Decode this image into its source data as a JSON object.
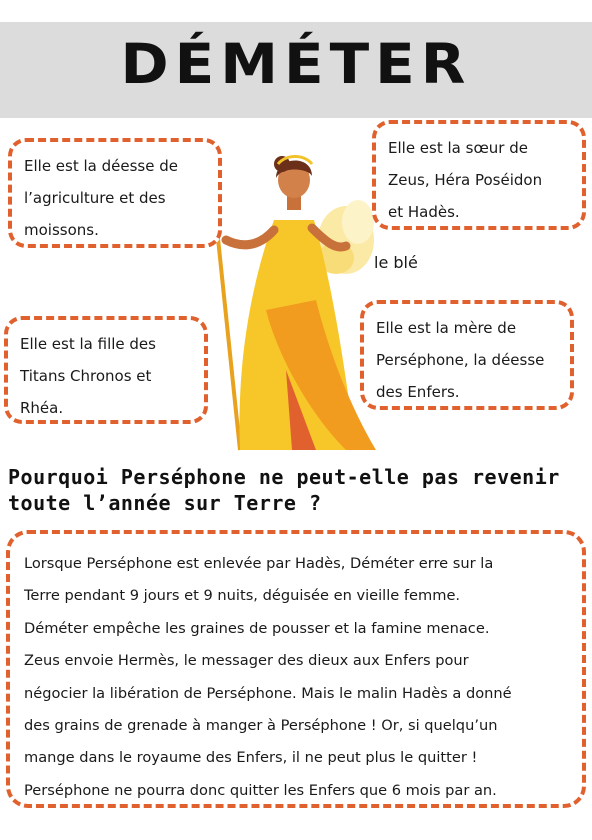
{
  "title": "DÉMÉTER",
  "boxes": {
    "agriculture": [
      "Elle est la déesse de",
      "l’agriculture et des",
      "moissons."
    ],
    "sister": [
      "Elle est la sœur de",
      "Zeus, Héra Poséidon",
      "et Hadès."
    ],
    "daughter": [
      "Elle est la fille des",
      "Titans Chronos et",
      "Rhéa."
    ],
    "mother": [
      "Elle est la mère de",
      "Perséphone, la déesse",
      "des Enfers."
    ]
  },
  "wheat_label": "le blé",
  "question": [
    "Pourquoi Perséphone ne peut-elle pas revenir",
    "toute l’année sur Terre ?"
  ],
  "story_lines": [
    "Lorsque Perséphone est enlevée par Hadès, Déméter erre sur la",
    "Terre pendant 9 jours et 9 nuits, déguisée en vieille femme.",
    "Déméter empêche les graines de pousser et la famine menace.",
    "Zeus envoie Hermès, le messager des dieux aux Enfers pour",
    "négocier la libération de Perséphone. Mais le malin Hadès a donné",
    "des grains de grenade à manger à Perséphone ! Or, si quelqu’un",
    "mange dans le royaume des Enfers, il ne peut plus le quitter !",
    "Perséphone ne pourra donc quitter les Enfers que 6 mois par an."
  ],
  "colors": {
    "accent": "#e0612d",
    "banner": "#dcdcdc",
    "dress": "#f7c72a"
  }
}
